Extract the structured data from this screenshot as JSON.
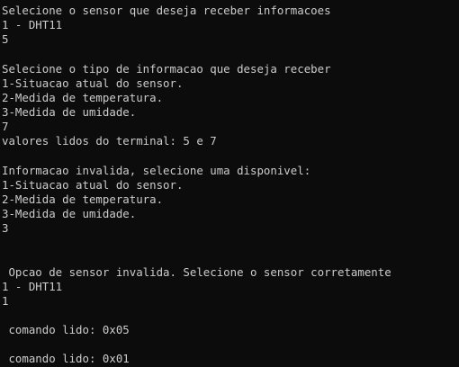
{
  "terminal": {
    "background_color": "#0c0c0c",
    "text_color": "#cccccc",
    "lines": [
      "Selecione o sensor que deseja receber informacoes",
      "1 - DHT11",
      "5",
      "",
      "Selecione o tipo de informacao que deseja receber",
      "1-Situacao atual do sensor.",
      "2-Medida de temperatura.",
      "3-Medida de umidade.",
      "7",
      "valores lidos do terminal: 5 e 7",
      "",
      "Informacao invalida, selecione uma disponivel:",
      "1-Situacao atual do sensor.",
      "2-Medida de temperatura.",
      "3-Medida de umidade.",
      "3",
      "",
      "",
      " Opcao de sensor invalida. Selecione o sensor corretamente",
      "1 - DHT11",
      "1",
      "",
      " comando lido: 0x05",
      "",
      " comando lido: 0x01"
    ]
  }
}
